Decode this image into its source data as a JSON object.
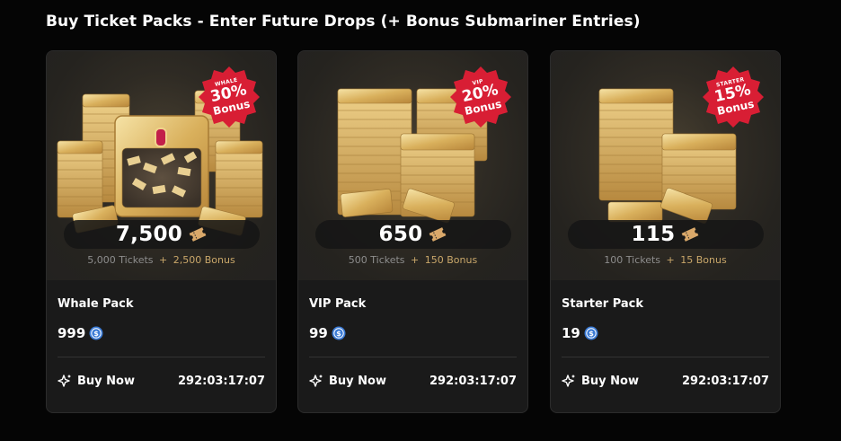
{
  "page": {
    "title": "Buy Ticket Packs - Enter Future Drops (+ Bonus Submariner Entries)"
  },
  "colors": {
    "background": "#050505",
    "card": "#1a1a1a",
    "badge_red": "#d81e34",
    "gold": "#d9b05c",
    "bonus_text": "#c9a76a",
    "coin_blue": "#3b7bd6"
  },
  "packs": [
    {
      "name": "Whale Pack",
      "badge_tag": "WHALE",
      "badge_pct": "30%",
      "badge_word": "Bonus",
      "amount": "7,500",
      "base": "5,000 Tickets",
      "plus": "+",
      "bonus": "2,500 Bonus",
      "price": "999",
      "buy_label": "Buy Now",
      "countdown": "292:03:17:07",
      "icons": {
        "ticket": "ticket-icon",
        "coin": "coin-icon",
        "buy": "sparkle-icon"
      }
    },
    {
      "name": "VIP Pack",
      "badge_tag": "VIP",
      "badge_pct": "20%",
      "badge_word": "Bonus",
      "amount": "650",
      "base": "500 Tickets",
      "plus": "+",
      "bonus": "150 Bonus",
      "price": "99",
      "buy_label": "Buy Now",
      "countdown": "292:03:17:07",
      "icons": {
        "ticket": "ticket-icon",
        "coin": "coin-icon",
        "buy": "sparkle-icon"
      }
    },
    {
      "name": "Starter Pack",
      "badge_tag": "STARTER",
      "badge_pct": "15%",
      "badge_word": "Bonus",
      "amount": "115",
      "base": "100 Tickets",
      "plus": "+",
      "bonus": "15 Bonus",
      "price": "19",
      "buy_label": "Buy Now",
      "countdown": "292:03:17:07",
      "icons": {
        "ticket": "ticket-icon",
        "coin": "coin-icon",
        "buy": "sparkle-icon"
      }
    }
  ]
}
